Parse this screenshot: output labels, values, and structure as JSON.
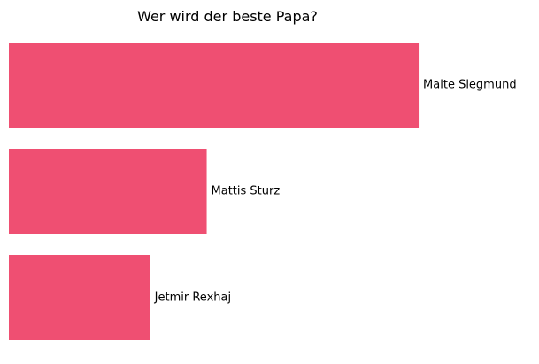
{
  "chart_data": {
    "type": "bar",
    "orientation": "horizontal",
    "title": "Wer wird der beste Papa?",
    "xlabel": "",
    "ylabel": "",
    "categories": [
      "Malte Siegmund",
      "Mattis Sturz",
      "Jetmir Rexhaj"
    ],
    "values": [
      29,
      14,
      10
    ],
    "xlim": [
      0,
      30.5
    ],
    "grid": false,
    "axes_visible": false,
    "legend": "none",
    "bar_color": "#ef4f72"
  }
}
